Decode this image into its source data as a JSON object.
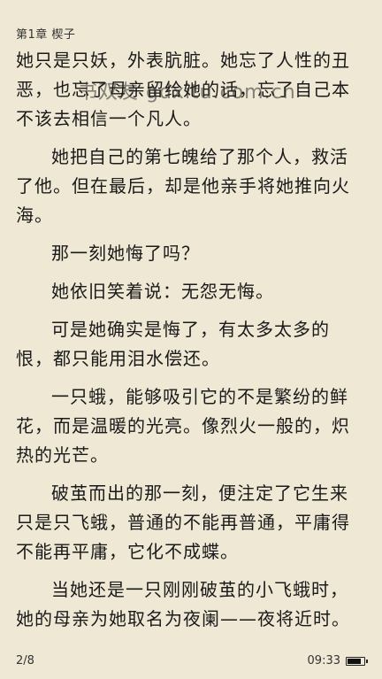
{
  "header": {
    "chapter_title": "第1章 楔子"
  },
  "watermark": "书双友 gdxitu.com.cn",
  "paragraphs": [
    {
      "text": "她只是只妖，外表肮脏。她忘了人性的丑恶，也忘了母亲留给她的话，忘了自己本不该去相信一个凡人。",
      "indent": false
    },
    {
      "text": "她把自己的第七魄给了那个人，救活了他。但在最后，却是他亲手将她推向火海。",
      "indent": true
    },
    {
      "text": "那一刻她悔了吗？",
      "indent": true
    },
    {
      "text": "她依旧笑着说：无怨无悔。",
      "indent": true
    },
    {
      "text": "可是她确实是悔了，有太多太多的恨，都只能用泪水偿还。",
      "indent": true
    },
    {
      "text": "一只蛾，能够吸引它的不是繁纷的鲜花，而是温暖的光亮。像烈火一般的，炽热的光芒。",
      "indent": true
    },
    {
      "text": "破茧而出的那一刻，便注定了它生来只是只飞蛾，普通的不能再普通，平庸得不能再平庸，它化不成蝶。",
      "indent": true
    },
    {
      "text": "当她还是一只刚刚破茧的小飞蛾时，她的母亲为她取名为夜阑——夜将近时。",
      "indent": true
    }
  ],
  "footer": {
    "page": "2/8",
    "time": "09:33",
    "battery_level": 0.9,
    "battery_icon": "battery-icon"
  },
  "colors": {
    "background": "#efe8d5",
    "text": "#1a1a1a"
  }
}
